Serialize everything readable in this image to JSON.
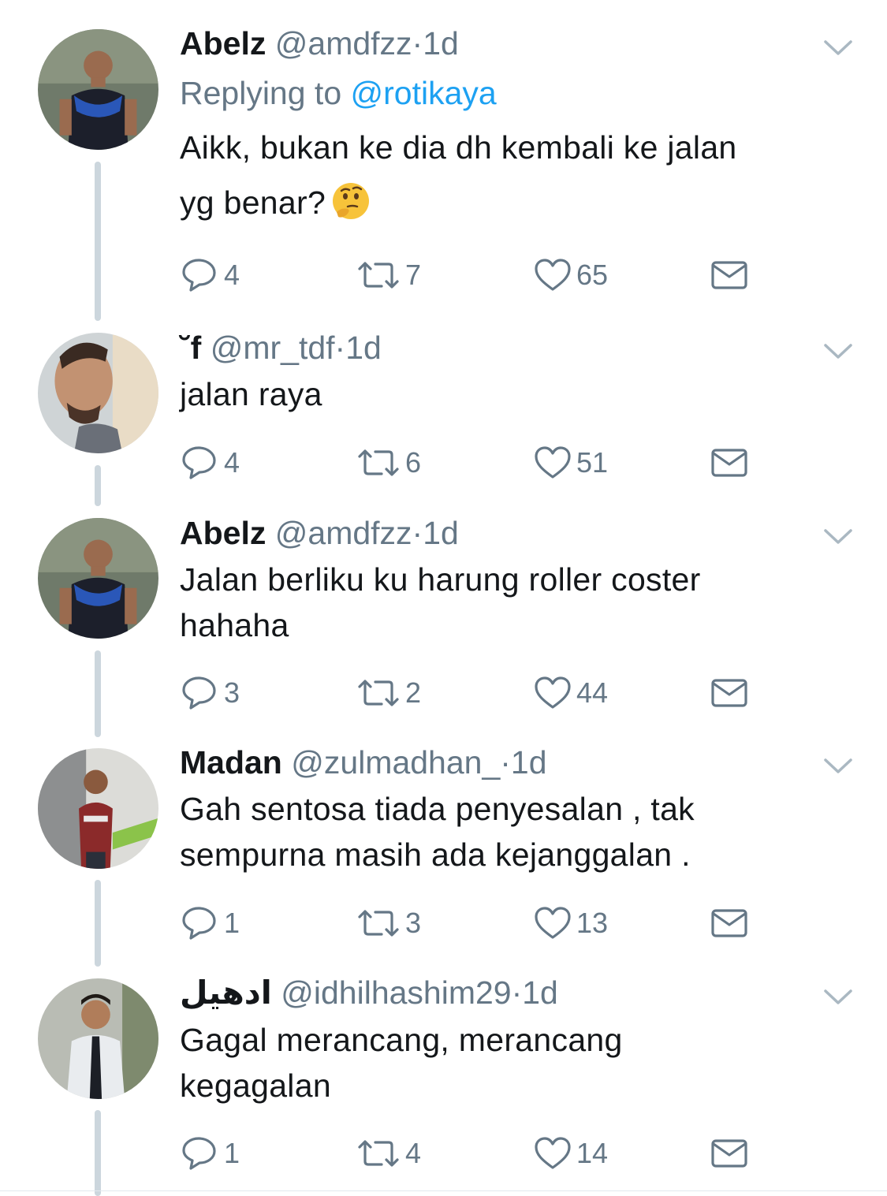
{
  "colors": {
    "name": "#14171a",
    "muted": "#657786",
    "link": "#1da1f2",
    "thread": "#ccd6dd"
  },
  "tweets": [
    {
      "name": "Abelz",
      "handle": "@amdfzz",
      "dot": "·",
      "time": "1d",
      "reply_prefix": "Replying to",
      "reply_handle": "@rotikaya",
      "text_lines": [
        "Aikk, bukan ke dia dh kembali ke jalan",
        "yg benar?"
      ],
      "emoji": "thinking-face",
      "replies": "4",
      "retweets": "7",
      "likes": "65"
    },
    {
      "name": "",
      "name_glyph": "˘f",
      "handle": "@mr_tdf",
      "dot": "·",
      "time": "1d",
      "text_lines": [
        "jalan raya"
      ],
      "replies": "4",
      "retweets": "6",
      "likes": "51"
    },
    {
      "name": "Abelz",
      "handle": "@amdfzz",
      "dot": "·",
      "time": "1d",
      "text_lines": [
        "Jalan berliku ku harung roller coster",
        "hahaha"
      ],
      "replies": "3",
      "retweets": "2",
      "likes": "44"
    },
    {
      "name": "Madan",
      "handle": "@zulmadhan_",
      "dot": "·",
      "time": "1d",
      "text_lines": [
        "Gah sentosa tiada penyesalan , tak",
        "sempurna masih ada kejanggalan ."
      ],
      "replies": "1",
      "retweets": "3",
      "likes": "13"
    },
    {
      "name": "ادهيل",
      "handle": "@idhilhashim29",
      "dot": "·",
      "time": "1d",
      "text_lines": [
        "Gagal merancang, merancang",
        "kegagalan"
      ],
      "replies": "1",
      "retweets": "4",
      "likes": "14"
    }
  ]
}
